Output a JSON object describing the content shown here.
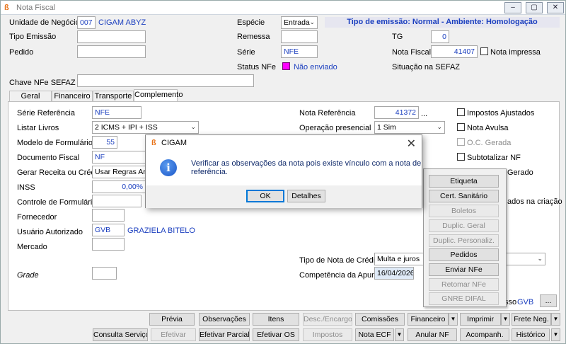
{
  "window": {
    "title": "Nota Fiscal",
    "controls": [
      "–",
      "▢",
      "✕"
    ]
  },
  "header": {
    "unidade_label": "Unidade de Negócio",
    "unidade_code": "007",
    "unidade_name": "CIGAM ABYZ",
    "tipo_emissao_label": "Tipo Emissão",
    "pedido_label": "Pedido",
    "especie_label": "Espécie",
    "especie_value": "Entrada",
    "remessa_label": "Remessa",
    "serie_label": "Série",
    "serie_value": "NFE",
    "status_label": "Status NFe",
    "status_value": "Não enviado",
    "status_color": "#ff00ff",
    "tipo_emissao_info": "Tipo de emissão: Normal - Ambiente: Homologação",
    "tg_label": "TG",
    "tg_value": "0",
    "nota_fiscal_label": "Nota Fiscal",
    "nota_fiscal_value": "41407",
    "nota_impressa_label": "Nota impressa",
    "situacao_label": "Situação na SEFAZ",
    "chave_label": "Chave NFe SEFAZ"
  },
  "tabs": [
    "Geral",
    "Financeiro",
    "Transporte",
    "Complemento"
  ],
  "complemento": {
    "serie_ref_label": "Série Referência",
    "serie_ref_value": "NFE",
    "listar_livros_label": "Listar Livros",
    "listar_livros_value": "2 ICMS + IPI + ISS",
    "modelo_label": "Modelo de Formulário",
    "modelo_value": "55",
    "doc_fiscal_label": "Documento Fiscal",
    "doc_fiscal_value": "NF",
    "gerar_label": "Gerar Receita ou Crédito",
    "gerar_value": "Usar Regras Arqui",
    "inss_label": "INSS",
    "inss_value": "0,00%",
    "controle_label": "Controle de Formulário",
    "fornecedor_label": "Fornecedor",
    "usuario_label": "Usuário Autorizado",
    "usuario_code": "GVB",
    "usuario_name": "GRAZIELA BITELO",
    "mercado_label": "Mercado",
    "grade_label": "Grade",
    "nota_ref_label": "Nota Referência",
    "nota_ref_value": "41372",
    "nota_ref_more": "...",
    "operacao_label": "Operação presencial",
    "operacao_value": "1 Sim",
    "tipo_credito_label": "Tipo de Nota de Crédito",
    "tipo_credito_value": "Multa e juros",
    "competencia_label": "Competência da Apuração",
    "competencia_value": "16/04/2026",
    "impostos_ajustados": "Impostos Ajustados",
    "nota_avulsa": "Nota Avulsa",
    "oc_gerada": "O.C. Gerada",
    "subtotalizar": "Subtotalizar NF",
    "gerado_partial": "Gerado",
    "criacao_partial": "ados na criação",
    "acesso_partial": "sso",
    "acesso_value": "GVB",
    "acesso_btn": "..."
  },
  "popup_menu": [
    {
      "label": "Etiqueta",
      "enabled": true
    },
    {
      "label": "Cert. Sanitário",
      "enabled": true
    },
    {
      "label": "Boletos",
      "enabled": false
    },
    {
      "label": "Duplic. Geral",
      "enabled": false
    },
    {
      "label": "Duplic. Personaliz.",
      "enabled": false
    },
    {
      "label": "Pedidos",
      "enabled": true
    },
    {
      "label": "Enviar NFe",
      "enabled": true
    },
    {
      "label": "Retomar NFe",
      "enabled": false
    },
    {
      "label": "GNRE DIFAL",
      "enabled": false
    }
  ],
  "dialog": {
    "title": "CIGAM",
    "message": "Verificar as observações da nota pois existe vínculo com a nota de referência.",
    "ok_label": "OK",
    "details_label": "Detalhes"
  },
  "toolbar_row1": [
    "Prévia",
    "Observações",
    "Itens",
    "Desc./Encargos",
    "Comissões",
    "Financeiro",
    "Imprimir",
    "Frete Neg."
  ],
  "toolbar_row2": [
    "Consulta Serviços",
    "Efetivar",
    "Efetivar Parcial",
    "Efetivar OS",
    "Impostos",
    "Nota ECF",
    "Anular NF",
    "Acompanh.",
    "Histórico"
  ]
}
